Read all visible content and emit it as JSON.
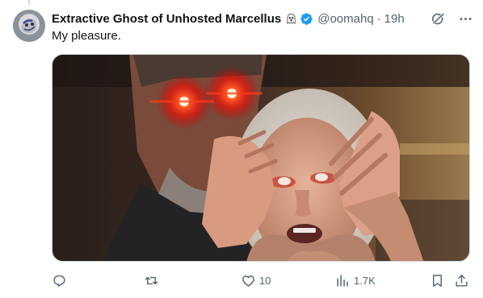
{
  "tweet": {
    "author": {
      "display_name": "Extractive Ghost of Unhosted Marcellus",
      "name_emoji": "ghost-emoji",
      "verified": true,
      "handle": "@oomahq",
      "separator": "·",
      "timestamp": "19h"
    },
    "text": "My pleasure.",
    "media": {
      "kind": "image",
      "description_icon": "meme-photo"
    },
    "actions": {
      "reply_count": "",
      "retweet_count": "",
      "like_count": "10",
      "view_count": "1.7K"
    }
  },
  "colors": {
    "text_primary": "#0f1419",
    "text_secondary": "#536471",
    "verified_blue": "#1d9bf0",
    "border": "#cfd9de"
  }
}
